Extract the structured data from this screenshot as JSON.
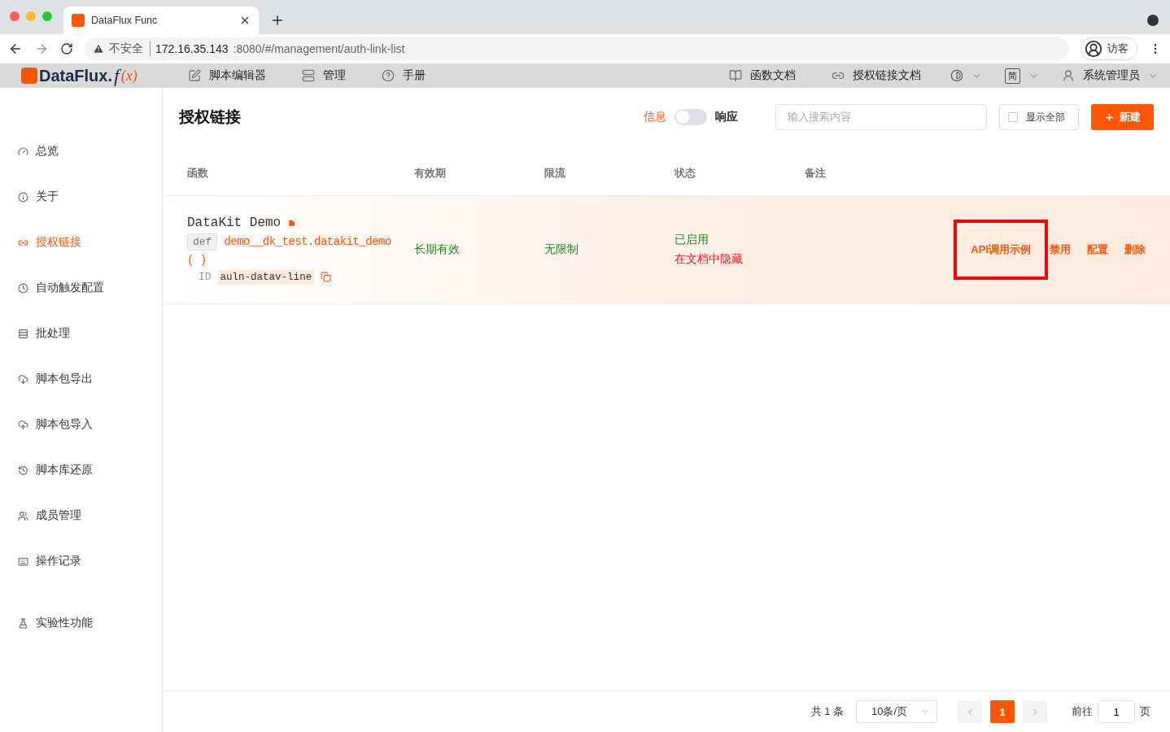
{
  "browser": {
    "tab_title": "DataFlux Func",
    "security": "不安全",
    "url_host": "172.16.35.143",
    "url_rest": ":8080/#/management/auth-link-list",
    "profile": "访客"
  },
  "nav": {
    "logo_name": "DataFlux.",
    "logo_f": "f",
    "logo_x": "(x)",
    "left": [
      {
        "kind": "edit",
        "label": "脚本编辑器"
      },
      {
        "kind": "manage",
        "label": "管理"
      },
      {
        "kind": "help",
        "label": "手册"
      }
    ],
    "right": [
      {
        "kind": "book",
        "label": "函数文档"
      },
      {
        "kind": "link",
        "label": "授权链接文档"
      }
    ],
    "lang": "简",
    "user": "系统管理员"
  },
  "sidebar": {
    "items": [
      {
        "kind": "gauge",
        "label": "总览",
        "selected": false
      },
      {
        "kind": "info",
        "label": "关于",
        "selected": false
      },
      {
        "kind": "link",
        "label": "授权链接",
        "selected": true
      },
      {
        "kind": "clock",
        "label": "自动触发配置",
        "selected": false
      },
      {
        "kind": "batch",
        "label": "批处理",
        "selected": false
      },
      {
        "kind": "download",
        "label": "脚本包导出",
        "selected": false
      },
      {
        "kind": "upload",
        "label": "脚本包导入",
        "selected": false
      },
      {
        "kind": "history",
        "label": "脚本库还原",
        "selected": false
      },
      {
        "kind": "users",
        "label": "成员管理",
        "selected": false
      },
      {
        "kind": "keyboard",
        "label": "操作记录",
        "selected": false
      }
    ],
    "bottom_items": [
      {
        "kind": "flask",
        "label": "实验性功能",
        "selected": false
      }
    ]
  },
  "header": {
    "title": "授权链接",
    "toggle_left": "信息",
    "toggle_right": "响应",
    "toggle_on": false,
    "search_placeholder": "输入搜索内容",
    "show_all": "显示全部",
    "show_all_checked": false,
    "new_button": "新建"
  },
  "table": {
    "columns": [
      "函数",
      "有效期",
      "限流",
      "状态",
      "备注"
    ],
    "rows": [
      {
        "hovered": true,
        "title": "DataKit Demo",
        "def_tag": "def",
        "func": "demo__dk_test.datakit_demo",
        "parens": "( )",
        "id_label": "ID",
        "id": "auln-datav-line",
        "expiry": "长期有效",
        "limit": "无限制",
        "status": [
          {
            "kind": "ok",
            "text": "已启用"
          },
          {
            "kind": "warn",
            "text": "在文档中隐藏"
          }
        ],
        "actions": [
          {
            "label": "API调用示例",
            "annotated": true
          },
          {
            "label": "禁用",
            "annotated": false
          },
          {
            "label": "配置",
            "annotated": false
          },
          {
            "label": "删除",
            "annotated": false
          }
        ]
      }
    ]
  },
  "pagination": {
    "total": "共 1 条",
    "page_size": "10条/页",
    "pages": [
      {
        "label": "1",
        "selected": true
      }
    ],
    "goto_label": "前往",
    "goto_value": "1",
    "page_unit": "页"
  }
}
